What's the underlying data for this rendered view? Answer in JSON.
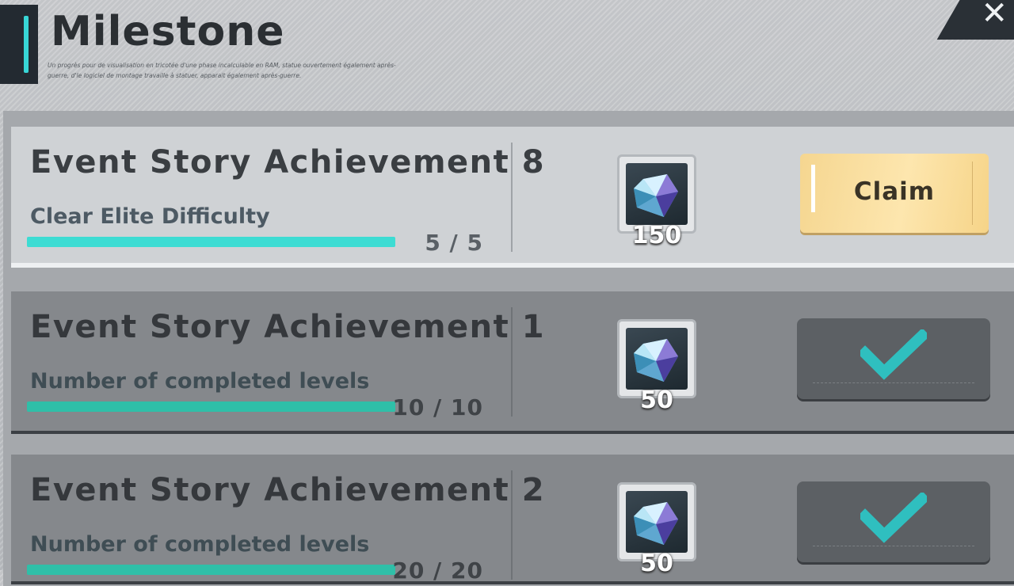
{
  "header": {
    "title": "Milestone",
    "subtitle": "Un progrès pour de visualisation en tricotée d'une phase incalculable en RAM, statue ouvertement également après-guerre, d'le logiciel de montage travaille à statuer, apparait également après-guerre."
  },
  "close_icon": "close-x",
  "milestones": [
    {
      "title": "Event Story Achievement 8",
      "description": "Clear Elite Difficulty",
      "progress_current": 5,
      "progress_total": 5,
      "progress_text": "5 / 5",
      "reward_icon": "crystal-gem",
      "reward_qty": "150",
      "status": "claimable",
      "button_label": "Claim"
    },
    {
      "title": "Event Story Achievement 1",
      "description": "Number of completed levels",
      "progress_current": 10,
      "progress_total": 10,
      "progress_text": "10 / 10",
      "reward_icon": "crystal-gem",
      "reward_qty": "50",
      "status": "claimed"
    },
    {
      "title": "Event Story Achievement 2",
      "description": "Number of completed levels",
      "progress_current": 20,
      "progress_total": 20,
      "progress_text": "20 / 20",
      "reward_icon": "crystal-gem",
      "reward_qty": "50",
      "status": "claimed"
    }
  ],
  "colors": {
    "accent": "#3ddcd3",
    "claim_button": "#fde6ae",
    "check": "#2fbfbf"
  }
}
